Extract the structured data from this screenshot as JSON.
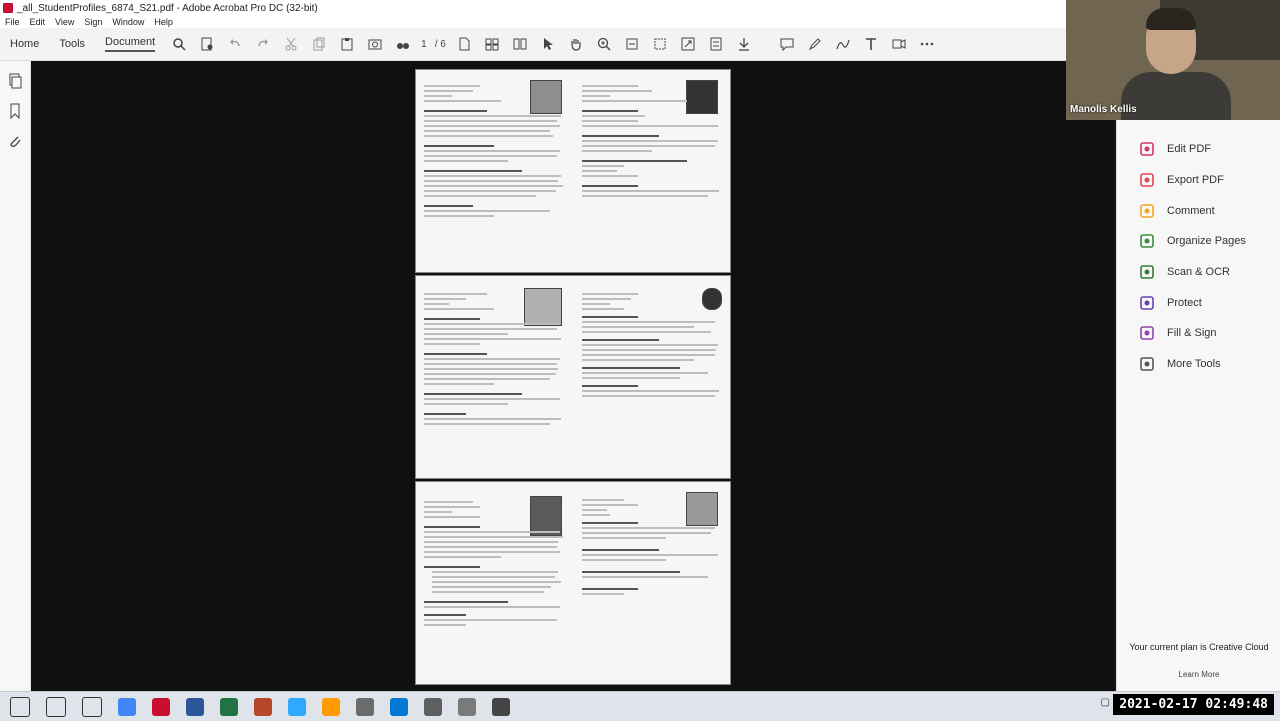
{
  "window": {
    "title": "_all_StudentProfiles_6874_S21.pdf - Adobe Acrobat Pro DC (32-bit)"
  },
  "menu": [
    "File",
    "Edit",
    "View",
    "Sign",
    "Window",
    "Help"
  ],
  "toolbar": {
    "tabs": [
      "Home",
      "Tools",
      "Document"
    ],
    "active_tab": "Document",
    "current_page": "1",
    "total_pages": "/ 6"
  },
  "webcam": {
    "participant_name": "Manolis Kellis"
  },
  "right_panel": {
    "items": [
      {
        "label": "Edit PDF",
        "icon": "edit-pdf-icon",
        "color": "#d6336c"
      },
      {
        "label": "Export PDF",
        "icon": "export-pdf-icon",
        "color": "#e34850"
      },
      {
        "label": "Comment",
        "icon": "comment-icon",
        "color": "#f5a623"
      },
      {
        "label": "Organize Pages",
        "icon": "organize-pages-icon",
        "color": "#3b8d3b"
      },
      {
        "label": "Scan & OCR",
        "icon": "scan-ocr-icon",
        "color": "#2e7d32"
      },
      {
        "label": "Protect",
        "icon": "protect-icon",
        "color": "#6a3fb5"
      },
      {
        "label": "Fill & Sign",
        "icon": "fill-sign-icon",
        "color": "#8e44ad"
      },
      {
        "label": "More Tools",
        "icon": "more-tools-icon",
        "color": "#555555"
      }
    ],
    "plan_text": "Your current plan is Creative Cloud",
    "learn_more": "Learn More"
  },
  "taskbar": {
    "apps": [
      "start",
      "task-view",
      "search",
      "chrome",
      "acrobat",
      "word",
      "excel",
      "powerpoint",
      "photoshop",
      "illustrator",
      "app",
      "mail",
      "app",
      "app",
      "app"
    ],
    "datetime": "2021-02-17  02:49:48"
  }
}
